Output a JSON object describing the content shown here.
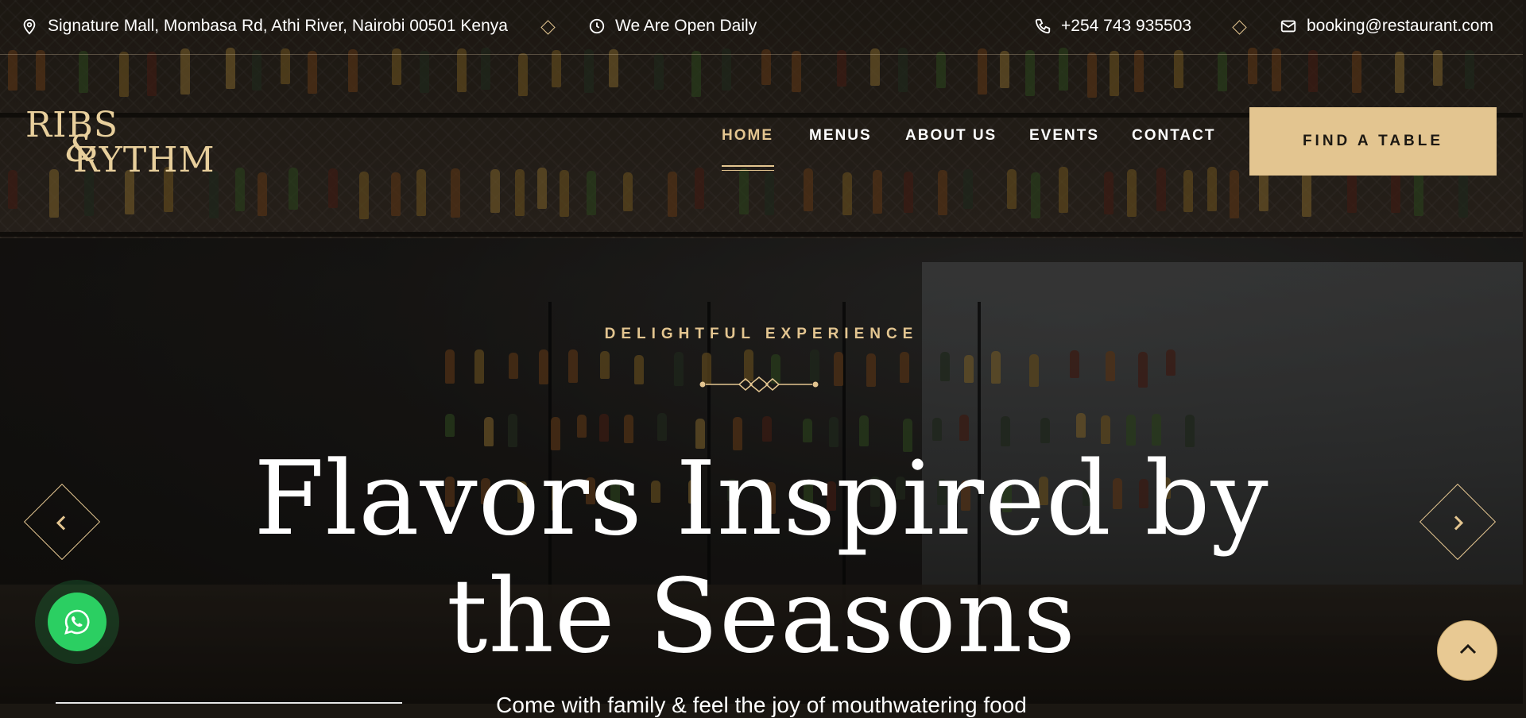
{
  "topbar": {
    "address": "Signature Mall, Mombasa Rd, Athi River, Nairobi 00501 Kenya",
    "hours": "We Are Open Daily",
    "phone": "+254 743 935503",
    "email": "booking@restaurant.com"
  },
  "logo": {
    "line1": "RIBS",
    "ampersand": "&",
    "line2": "RYTHM"
  },
  "nav": {
    "items": [
      {
        "label": "HOME",
        "active": true
      },
      {
        "label": "MENUS",
        "active": false
      },
      {
        "label": "ABOUT US",
        "active": false
      },
      {
        "label": "EVENTS",
        "active": false
      },
      {
        "label": "CONTACT",
        "active": false
      }
    ],
    "cta": "FIND A TABLE"
  },
  "hero": {
    "eyebrow": "DELIGHTFUL EXPERIENCE",
    "headline_line1": "Flavors Inspired by",
    "headline_line2": "the Seasons",
    "subline": "Come with family & feel the joy of mouthwatering food"
  },
  "icons": {
    "address": "map-pin-icon",
    "hours": "clock-icon",
    "phone": "phone-icon",
    "email": "mail-icon",
    "prev": "chevron-left-icon",
    "next": "chevron-right-icon",
    "whatsapp": "whatsapp-icon",
    "to_top": "chevron-up-icon"
  },
  "colors": {
    "accent": "#e3c590",
    "cta_text": "#1c1812",
    "whatsapp": "#2bcf62"
  }
}
